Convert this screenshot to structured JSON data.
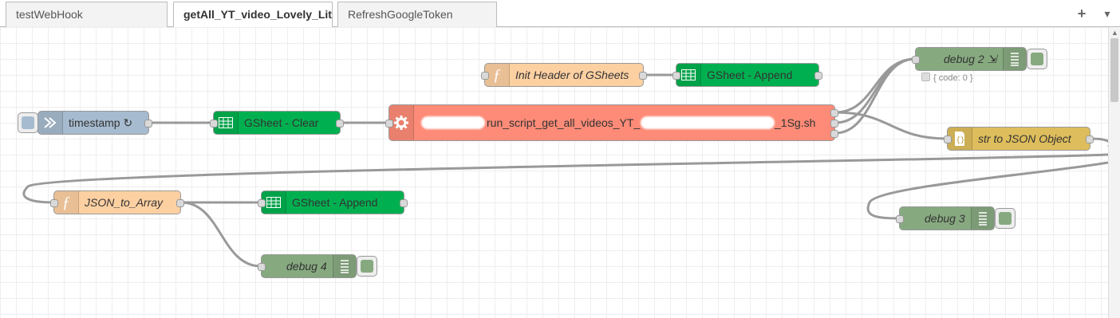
{
  "tabs": [
    {
      "label": "testWebHook",
      "active": false
    },
    {
      "label": "getAll_YT_video_Lovely_Lit",
      "active": true
    },
    {
      "label": "RefreshGoogleToken",
      "active": false
    }
  ],
  "toolbar": {
    "add_symbol": "+",
    "menu_symbol": "▾"
  },
  "nodes": {
    "init_header": {
      "label": "Init Header of GSheets",
      "icon": "function-icon",
      "color": "#fdd0a2"
    },
    "gsheet_append_top": {
      "label": "GSheet - Append",
      "icon": "table-icon",
      "color": "#00b050"
    },
    "debug2": {
      "label": "debug 2 ⇲",
      "icon": "list-icon",
      "color": "#87a980",
      "status": "{ code: 0 }"
    },
    "timestamp": {
      "label": "timestamp ↻",
      "icon": "arrow-icon",
      "color": "#a6bbcf"
    },
    "gsheet_clear": {
      "label": "GSheet - Clear",
      "icon": "table-icon",
      "color": "#00b050"
    },
    "exec": {
      "label_mid": "run_script_get_all_videos_YT_",
      "label_end": "_1Sg.sh",
      "icon": "gear-icon",
      "color": "#fd8b77"
    },
    "str_to_json": {
      "label": "str to JSON Object",
      "icon": "json-icon",
      "color": "#debd5c"
    },
    "json_to_array": {
      "label": "JSON_to_Array",
      "icon": "function-icon",
      "color": "#fdd0a2"
    },
    "gsheet_append_bottom": {
      "label": "GSheet - Append",
      "icon": "table-icon",
      "color": "#00b050"
    },
    "debug3": {
      "label": "debug 3",
      "icon": "list-icon",
      "color": "#87a980"
    },
    "debug4": {
      "label": "debug 4",
      "icon": "list-icon",
      "color": "#87a980"
    }
  }
}
